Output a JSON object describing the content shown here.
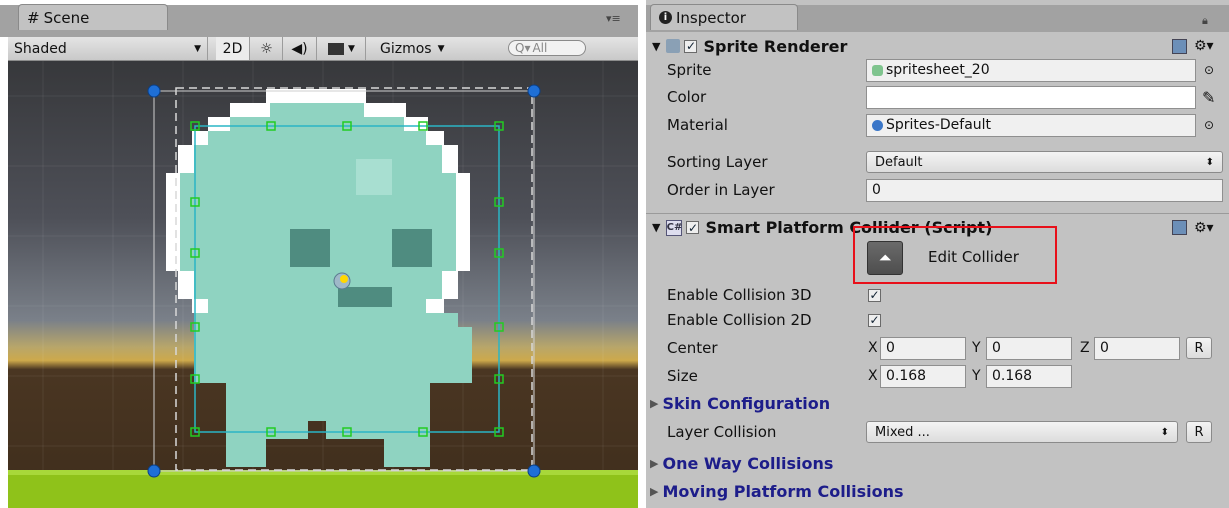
{
  "scene": {
    "tab_label": "Scene",
    "shading_mode": "Shaded",
    "mode_2d": "2D",
    "gizmos_label": "Gizmos",
    "search_placeholder": "All"
  },
  "inspector": {
    "tab_label": "Inspector",
    "sprite_renderer": {
      "title": "Sprite Renderer",
      "sprite_label": "Sprite",
      "sprite_value": "spritesheet_20",
      "color_label": "Color",
      "color_value": "#ffffff",
      "material_label": "Material",
      "material_value": "Sprites-Default",
      "sorting_layer_label": "Sorting Layer",
      "sorting_layer_value": "Default",
      "order_label": "Order in Layer",
      "order_value": "0"
    },
    "collider": {
      "title": "Smart Platform Collider (Script)",
      "edit_button": "Edit Collider",
      "enable3d_label": "Enable Collision 3D",
      "enable3d_checked": true,
      "enable2d_label": "Enable Collision 2D",
      "enable2d_checked": true,
      "center_label": "Center",
      "center": {
        "x": "0",
        "y": "0",
        "z": "0"
      },
      "size_label": "Size",
      "size": {
        "x": "0.168",
        "y": "0.168"
      },
      "reset_label": "R",
      "skin_label": "Skin Configuration",
      "layer_collision_label": "Layer Collision",
      "layer_collision_value": "Mixed ...",
      "one_way_label": "One Way Collisions",
      "moving_platform_label": "Moving Platform Collisions"
    },
    "axis_labels": {
      "x": "X",
      "y": "Y",
      "z": "Z"
    }
  },
  "colors": {
    "highlight_box": "#e8101a",
    "sprite_body": "#8fd3c1",
    "sprite_outline": "#ffffff",
    "ground": "#8fc21a",
    "selection_handle": "#1e6fd6",
    "collider_points": "#22cc22"
  }
}
